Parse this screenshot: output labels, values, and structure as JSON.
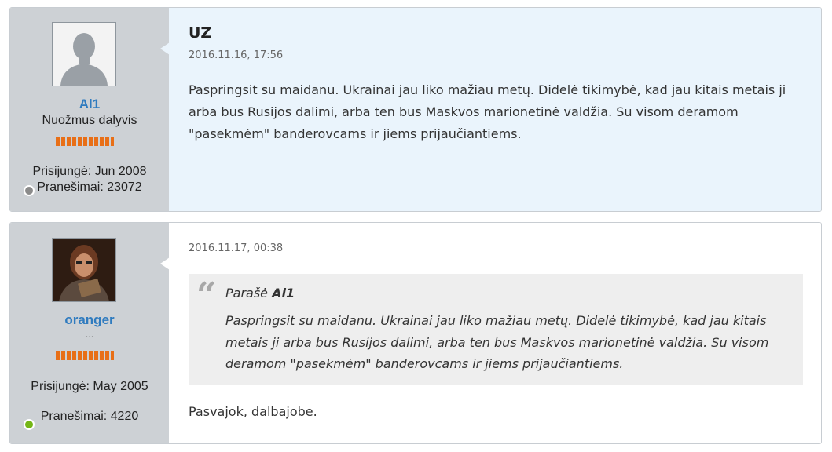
{
  "posts": [
    {
      "author": {
        "username": "Al1",
        "rank": "Nuožmus dalyvis",
        "joined": "Prisijungė: Jun 2008",
        "posts": "Pranešimai: 23072",
        "status": "offline",
        "avatar_icon": "default-user-silhouette-icon"
      },
      "title": "UZ",
      "date": "2016.11.16, 17:56",
      "text": "Paspringsit su maidanu. Ukrainai jau liko mažiau metų. Didelė tikimybė, kad jau kitais metais ji arba bus Rusijos dalimi, arba ten bus Maskvos marionetinė valdžia. Su visom deramom \"pasekmėm\" banderovcams ir jiems prijaučiantiems."
    },
    {
      "author": {
        "username": "oranger",
        "rank": "...",
        "joined": "Prisijungė: May 2005",
        "posts": "Pranešimai: 4220",
        "status": "online",
        "avatar_icon": "user-photo-avatar"
      },
      "date": "2016.11.17, 00:38",
      "quote": {
        "prefix": "Parašė",
        "author": "Al1",
        "text": "Paspringsit su maidanu. Ukrainai jau liko mažiau metų. Didelė tikimybė, kad jau kitais metais ji arba bus Rusijos dalimi, arba ten bus Maskvos marionetinė valdžia. Su visom deramom \"pasekmėm\" banderovcams ir jiems prijaučiantiems."
      },
      "text": "Pasvajok, dalbajobe."
    }
  ],
  "colors": {
    "username": "#2f7bbf",
    "reputation": "#e86f17",
    "online": "#74b616",
    "offline": "#8b8b8b",
    "post_highlight_bg": "#eaf4fc",
    "sidebar_bg": "#cdd1d5"
  }
}
